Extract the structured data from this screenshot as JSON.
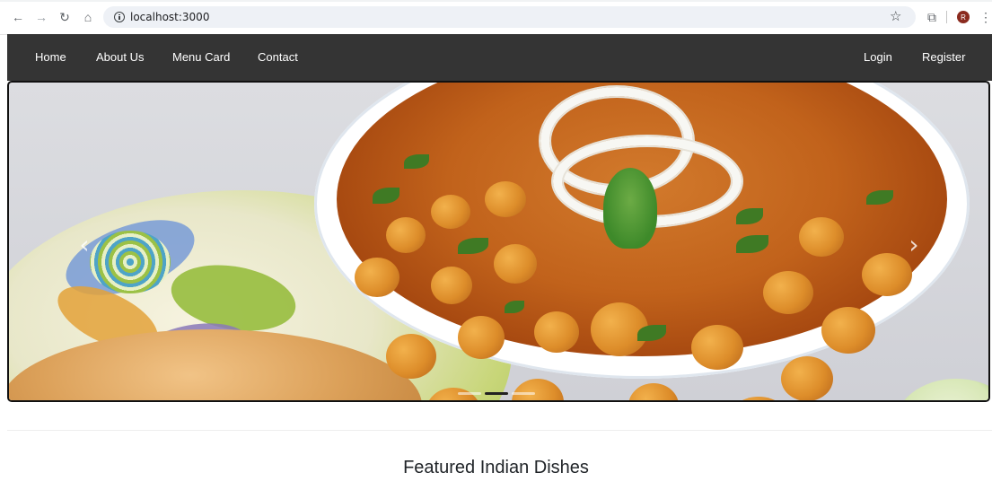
{
  "browser": {
    "url": "localhost:3000",
    "profile_initial": "R",
    "icons": [
      "back-arrow-icon",
      "forward-arrow-icon",
      "reload-icon",
      "home-icon",
      "info-icon",
      "star-icon",
      "extensions-icon",
      "profile-icon",
      "menu-dots-icon"
    ]
  },
  "navbar": {
    "left_links": [
      "Home",
      "About Us",
      "Menu Card",
      "Contact"
    ],
    "right_links": [
      "Login",
      "Register"
    ],
    "background": "#343434"
  },
  "carousel": {
    "image_description": "chole",
    "prev_label": "‹",
    "next_label": "›",
    "indicator_count": 3,
    "active_indicator": 2
  },
  "main": {
    "section_title": "Featured Indian Dishes"
  }
}
